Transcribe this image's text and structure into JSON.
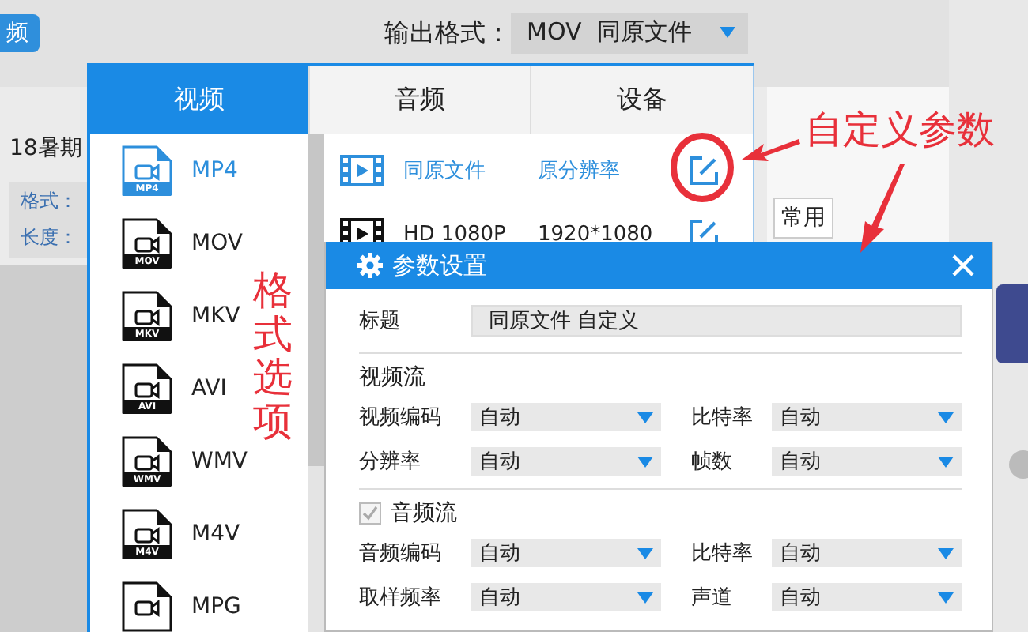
{
  "app": {
    "tab_button": "频",
    "output_format": {
      "label": "输出格式：",
      "value": "MOV  同原文件"
    },
    "file_title": "18暑期",
    "file_info": [
      "格式：",
      "长度："
    ],
    "common_button": "常用"
  },
  "format_popup": {
    "tabs": [
      {
        "label": "视频",
        "selected": true
      },
      {
        "label": "音频",
        "selected": false
      },
      {
        "label": "设备",
        "selected": false
      }
    ],
    "formats": [
      {
        "label": "MP4",
        "badge": "MP4",
        "selected": true
      },
      {
        "label": "MOV",
        "badge": "MOV",
        "selected": false
      },
      {
        "label": "MKV",
        "badge": "MKV",
        "selected": false
      },
      {
        "label": "AVI",
        "badge": "AVI",
        "selected": false
      },
      {
        "label": "WMV",
        "badge": "WMV",
        "selected": false
      },
      {
        "label": "M4V",
        "badge": "M4V",
        "selected": false
      },
      {
        "label": "MPG",
        "selected": false
      }
    ],
    "presets": [
      {
        "name": "同原文件",
        "resolution": "原分辨率",
        "selected": true
      },
      {
        "name": "HD 1080P",
        "resolution": "1920*1080",
        "selected": false
      }
    ]
  },
  "params_dialog": {
    "title": "参数设置",
    "title_label": "标题",
    "title_value": "同原文件 自定义",
    "sections": [
      {
        "kind": "heading",
        "heading": "视频流",
        "rows": [
          [
            {
              "label": "视频编码",
              "value": "自动"
            },
            {
              "label": "比特率",
              "value": "自动"
            }
          ],
          [
            {
              "label": "分辨率",
              "value": "自动"
            },
            {
              "label": "帧数",
              "value": "自动"
            }
          ]
        ]
      },
      {
        "kind": "checkbox",
        "heading": "音频流",
        "checked": true,
        "rows": [
          [
            {
              "label": "音频编码",
              "value": "自动"
            },
            {
              "label": "比特率",
              "value": "自动"
            }
          ],
          [
            {
              "label": "取样频率",
              "value": "自动"
            },
            {
              "label": "声道",
              "value": "自动"
            }
          ]
        ]
      }
    ]
  },
  "annotations": [
    {
      "kind": "horizontal",
      "text": "自定义参数"
    },
    {
      "kind": "vertical",
      "text": "格式选项"
    }
  ]
}
